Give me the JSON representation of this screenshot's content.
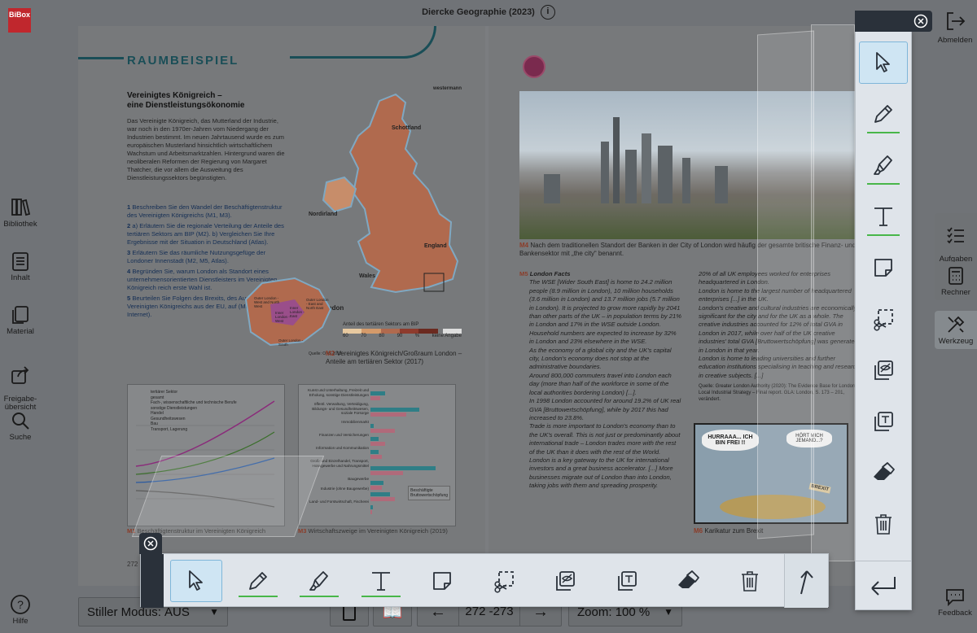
{
  "app": {
    "logo": "BiBox",
    "title": "Diercke Geographie (2023)"
  },
  "left_nav": [
    {
      "id": "library",
      "label": "Bibliothek",
      "icon": "books-icon"
    },
    {
      "id": "contents",
      "label": "Inhalt",
      "icon": "contents-icon"
    },
    {
      "id": "material",
      "label": "Material",
      "icon": "material-icon"
    },
    {
      "id": "share",
      "label": "Freigabe-\nübersicht",
      "icon": "share-icon"
    },
    {
      "id": "search",
      "label": "Suche",
      "icon": "search-icon"
    },
    {
      "id": "help",
      "label": "Hilfe",
      "icon": "help-icon"
    }
  ],
  "right_nav": {
    "logout": "Abmelden",
    "tasks": "Aufgaben\nManager",
    "calculator": "Rechner",
    "tools": "Werkzeug",
    "feedback": "Feedback"
  },
  "book": {
    "left": {
      "section_title": "RAUMBEISPIEL",
      "heading_line1": "Vereinigtes Königreich –",
      "heading_line2": "eine Dienstleistungsökonomie",
      "intro": "Das Vereinigte Königreich, das Mutterland der Industrie, war noch in den 1970er-Jahren vom Niedergang der Industrien bestimmt. Im neuen Jahrtausend wurde es zum europäischen Musterland hinsichtlich wirtschaftlichem Wachstum und Arbeitsmarktzahlen. Hintergrund waren die neoliberalen Reformen der Regierung von Margaret Thatcher, die vor allem die Ausweitung des Dienstleistungssektors begünstigten.",
      "tasks": [
        {
          "n": "1",
          "text": "Beschreiben Sie den Wandel der Beschäftigtenstruktur des Vereinigten Königreichs (M1, M3)."
        },
        {
          "n": "2",
          "text": "a) Erläutern Sie die regionale Verteilung der Anteile des tertiären Sektors am BIP (M2). b) Vergleichen Sie Ihre Ergebnisse mit der Situation in Deutschland (Atlas)."
        },
        {
          "n": "3",
          "text": "Erläutern Sie das räumliche Nutzungsgefüge der Londoner Innenstadt (M2, M5, Atlas)."
        },
        {
          "n": "4",
          "text": "Begründen Sie, warum London als Standort eines unternehmensorientierten Dienstleisters im Vereinigten Königreich reich erste Wahl ist."
        },
        {
          "n": "5",
          "text": "Beurteilen Sie Folgen des Brexits, des Austritts des Vereinigten Königreichs aus der EU, auf (M5, M6, Internet)."
        }
      ],
      "map_labels": [
        "Schottland",
        "Nordirland",
        "England",
        "Wales",
        "London"
      ],
      "london_labels": [
        "Outer London - West and North West",
        "Inner London - West",
        "Inner London - East",
        "Outer London - East and North East",
        "Outer London - South"
      ],
      "map_legend_title": "Anteil des tertiären Sektors am BIP",
      "map_legend_values": [
        "60",
        "70",
        "80",
        "90",
        "%",
        "keine Angabe"
      ],
      "map_source": "Quelle: ONS 2018",
      "map_publisher": "westermann",
      "m2_label": "M2",
      "m2_caption": "Vereinigtes Königreich/Großraum London – Anteile am tertiären Sektor (2017)",
      "m1_label": "M1",
      "m1_caption": "Beschäftigtenstruktur im Vereinigten Königreich",
      "m3_label": "M3",
      "m3_caption": "Wirtschaftszweige im Vereinigten Königreich (2019)",
      "m1_legend": [
        "tertiärer Sektor",
        "gesamt",
        "Fach-, wissenschaftliche und technische Berufe",
        "sonstige Dienstleistungen",
        "Handel",
        "Gesundheitswesen",
        "Bau",
        "Transport, Lagerung"
      ],
      "m3_categories": [
        "Kunst und Unterhaltung, Freizeit und Erholung, sonstige Dienstleistungen",
        "öffentl. Verwaltung, Verteidigung, Bildungs- und Gesundheitswesen, soziale Fürsorge",
        "Immobilienmarkt",
        "Finanzen und Versicherungen",
        "Information und Kommunikation",
        "Groß- und Einzelhandel, Transport, Hotelgewerbe und Nahrungsmittel",
        "Baugewerbe",
        "Industrie (ohne Baugewerbe)",
        "Land- und Forstwirtschaft, Fischerei"
      ],
      "m3_legend": [
        "Beschäftigte",
        "Bruttowertschöpfung"
      ],
      "page_number": "272"
    },
    "right": {
      "m4_label": "M4",
      "m4_caption": "Nach dem traditionellen Standort der Banken in der City of London wird häufig der gesamte britische Finanz- und Bankensektor mit „the city“ benannt.",
      "m5_label": "M5",
      "m5_title": "London Facts",
      "col1": [
        "The WSE [Wider South East] is home to 24.2 million people (8.9 million in London), 10 million households (3.6 million in London) and 13.7 million jobs (5.7 million in London). It is projected to grow more rapidly by 2041 than other parts of the UK – in population terms by 21% in London and 17% in the WSE outside London. Household numbers are expected to increase by 32% in London and 23% elsewhere in the WSE.",
        "As the economy of a global city and the UK's capital city, London's economy does not stop at the administrative boundaries.",
        "Around 800,000 commuters travel into London each day (more than half of the workforce in some of the local authorities bordering London) [...].",
        "In 1998 London accounted for around 19.2% of UK real GVA [Bruttowertschöpfung], while by 2017 this had increased to 23.8%.",
        "Trade is more important to London's economy than to the UK's overall. This is not just or predominantly about international trade – London trades more with the rest of the UK than it does with the rest of the World.",
        "London is a key gateway to the UK for international investors and a great business accelerator. [...] More businesses migrate out of London than into London, taking jobs with them and spreading prosperity."
      ],
      "col2": [
        "20% of all UK employees worked for enterprises headquartered in London.",
        "London is home to the largest number of headquartered enterprises [...] in the UK.",
        "London's creative and cultural industries are economically significant for the city and for the UK as a whole. The creative industries accounted for 12% of total GVA in London in 2017, while over half of the UK creative industries' total GVA [Bruttowertschöpfung] was generated in London in that year.",
        "London is home to leading universities and further education institutions specialising in teaching and research in creative subjects. [...]"
      ],
      "col2_source": "Quelle: Greater London Authority (2020): The Evidence Base for London's Local Industrial Strategy – Final report. GLA: London, S. 173 – 201, verändert.",
      "cartoon_text1": "HURRAAA... ICH BIN FREI !!",
      "cartoon_text2": "HÖRT MICH JEMAND...?",
      "cartoon_sign": "BREXIT",
      "m6_label": "M6",
      "m6_caption": "Karikatur zum Brexit"
    }
  },
  "toolbar": {
    "tools": [
      {
        "id": "select",
        "icon": "cursor-icon",
        "active": true,
        "underline": false
      },
      {
        "id": "pen",
        "icon": "pen-icon",
        "active": false,
        "underline": true
      },
      {
        "id": "highlighter",
        "icon": "highlighter-icon",
        "active": false,
        "underline": true
      },
      {
        "id": "text",
        "icon": "text-icon",
        "active": false,
        "underline": true
      },
      {
        "id": "note",
        "icon": "sticky-note-icon",
        "active": false,
        "underline": false
      },
      {
        "id": "cut",
        "icon": "scissors-icon",
        "active": false,
        "underline": false
      },
      {
        "id": "mask",
        "icon": "hide-area-icon",
        "active": false,
        "underline": false
      },
      {
        "id": "textbox",
        "icon": "text-frame-icon",
        "active": false,
        "underline": false
      },
      {
        "id": "eraser",
        "icon": "eraser-icon",
        "active": false,
        "underline": false
      },
      {
        "id": "delete",
        "icon": "trash-icon",
        "active": false,
        "underline": false
      }
    ],
    "accent": "#48b649",
    "active_bg": "#cfe5f3"
  },
  "bottom": {
    "silent_label": "Stiller Modus:",
    "silent_value": "AUS",
    "pages": "272 -273",
    "zoom_label": "Zoom:",
    "zoom_value": "100 %"
  }
}
